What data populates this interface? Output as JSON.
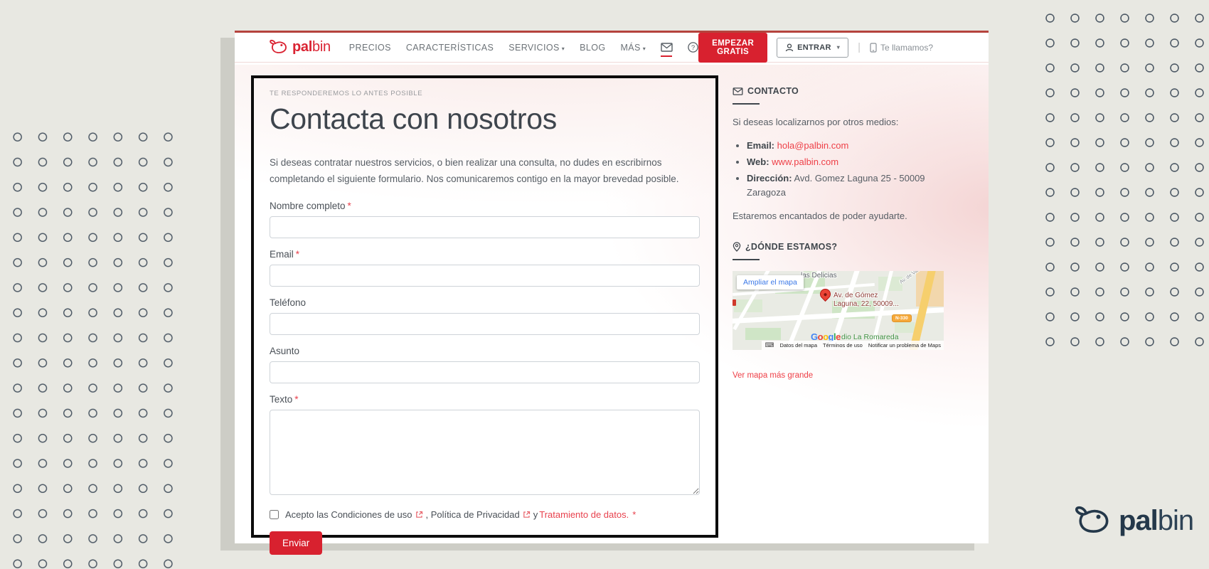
{
  "nav": {
    "logo": {
      "bold": "pal",
      "light": "bin"
    },
    "items": [
      "PRECIOS",
      "CARACTERÍSTICAS",
      "SERVICIOS",
      "BLOG",
      "MÁS"
    ],
    "cta": "EMPEZAR GRATIS",
    "login": "ENTRAR",
    "call": "Te llamamos?"
  },
  "form": {
    "eyebrow": "TE RESPONDEREMOS LO ANTES POSIBLE",
    "title": "Contacta con nosotros",
    "intro": "Si deseas contratar nuestros servicios, o bien realizar una consulta, no dudes en escribirnos completando el siguiente formulario. Nos comunicaremos contigo en la mayor brevedad posible.",
    "fields": [
      {
        "label": "Nombre completo",
        "req": "*"
      },
      {
        "label": "Email",
        "req": "*"
      },
      {
        "label": "Teléfono"
      },
      {
        "label": "Asunto"
      },
      {
        "label": "Texto",
        "req": "*"
      }
    ],
    "consent": {
      "text1": "Acepto las Condiciones de uso",
      "text2": ", Política de Privacidad",
      "text3": " y ",
      "link": "Tratamiento de datos.",
      "req": "*"
    },
    "submit": "Enviar"
  },
  "sidebar": {
    "contact": {
      "title": "CONTACTO",
      "intro": "Si deseas localizarnos por otros medios:",
      "email_label": "Email:",
      "email_value": "hola@palbin.com",
      "web_label": "Web:",
      "web_value": "www.palbin.com",
      "address_label": "Dirección:",
      "address_value": "Avd. Gomez Laguna 25 - 50009 Zaragoza",
      "outro": "Estaremos encantados de poder ayudarte."
    },
    "where": {
      "title": "¿DÓNDE ESTAMOS?"
    },
    "map": {
      "expand": "Ampliar el mapa",
      "area": "las Delicias",
      "street": "Av. de Vale",
      "pin1": "Av. de Gómez",
      "pin2": "Laguna, 22, 50009...",
      "badge": "N-330",
      "google": [
        {
          "ch": "G",
          "color": "#4285F4"
        },
        {
          "ch": "o",
          "color": "#EA4335"
        },
        {
          "ch": "o",
          "color": "#FBBC05"
        },
        {
          "ch": "g",
          "color": "#4285F4"
        },
        {
          "ch": "l",
          "color": "#34A853"
        },
        {
          "ch": "e",
          "color": "#EA4335"
        }
      ],
      "stadium": "dio La Romareda",
      "attr": [
        "Datos del mapa",
        "Términos de uso",
        "Notificar un problema de Maps"
      ],
      "link": "Ver mapa más grande"
    }
  },
  "footer_logo": {
    "bold": "pal",
    "light": "bin"
  },
  "colors": {
    "brand_red": "#d8212f",
    "link_red": "#ee4048",
    "navy": "#24384a"
  }
}
